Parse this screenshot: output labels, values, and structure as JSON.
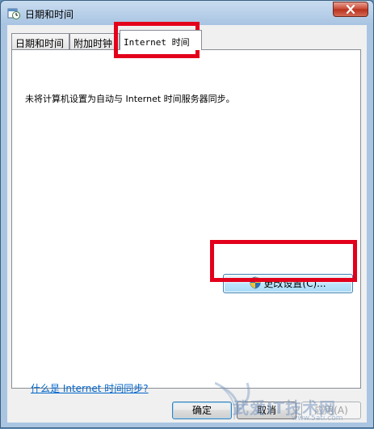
{
  "window": {
    "title": "日期和时间",
    "close_label": "×"
  },
  "tabs": [
    {
      "label": "日期和时间",
      "active": false
    },
    {
      "label": "附加时钟",
      "active": false
    },
    {
      "label": "Internet 时间",
      "active": true
    }
  ],
  "panel": {
    "info_text": "未将计算机设置为自动与 Internet 时间服务器同步。",
    "change_button_label": "更改设置(C)...",
    "help_link": "什么是 Internet 时间同步?"
  },
  "buttons": {
    "ok": "确定",
    "cancel": "取消",
    "apply": "应用(A)"
  },
  "watermark": {
    "text": "武爱IT技术网",
    "sub": "www.5ati.com"
  },
  "colors": {
    "highlight": "#e3001b",
    "link": "#0066cc"
  }
}
